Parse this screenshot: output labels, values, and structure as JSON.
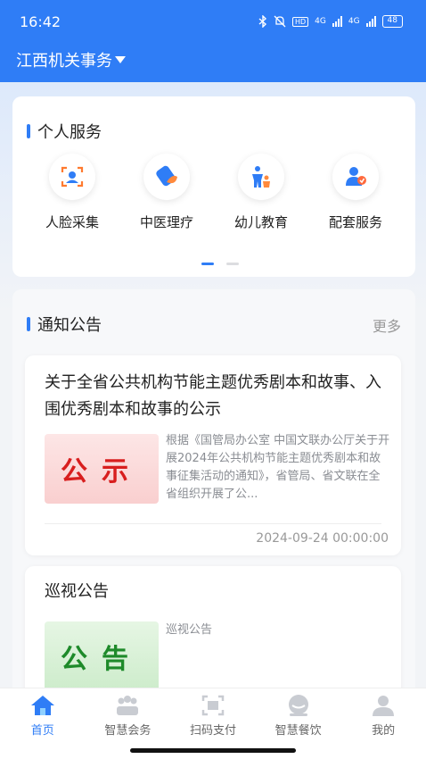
{
  "status": {
    "time": "16:42",
    "network": "4G",
    "battery": "48"
  },
  "header": {
    "org_name": "江西机关事务"
  },
  "services": {
    "title": "个人服务",
    "items": [
      {
        "label": "人脸采集",
        "icon": "face-scan-icon",
        "color": "#ff7a2f"
      },
      {
        "label": "中医理疗",
        "icon": "medicine-icon",
        "color": "#2f7df6"
      },
      {
        "label": "幼儿教育",
        "icon": "child-icon",
        "color": "#2f7df6"
      },
      {
        "label": "配套服务",
        "icon": "user-service-icon",
        "color": "#2f7df6"
      }
    ],
    "page_count": 2,
    "current_page": 1
  },
  "notices": {
    "title": "通知公告",
    "more_label": "更多",
    "items": [
      {
        "title": "关于全省公共机构节能主题优秀剧本和故事、入围优秀剧本和故事的公示",
        "thumb_text": "公示",
        "excerpt": "根据《国管局办公室 中国文联办公厅关于开展2024年公共机构节能主题优秀剧本和故事征集活动的通知》，省管局、省文联在全省组织开展了公...",
        "date": "2024-09-24 00:00:00"
      },
      {
        "title": "巡视公告",
        "thumb_text": "公告",
        "excerpt": "巡视公告"
      }
    ]
  },
  "tabbar": {
    "items": [
      {
        "label": "首页",
        "icon": "home-icon",
        "active": true
      },
      {
        "label": "智慧会务",
        "icon": "meeting-icon",
        "active": false
      },
      {
        "label": "扫码支付",
        "icon": "scan-icon",
        "active": false
      },
      {
        "label": "智慧餐饮",
        "icon": "dining-icon",
        "active": false
      },
      {
        "label": "我的",
        "icon": "profile-icon",
        "active": false
      }
    ]
  },
  "colors": {
    "primary": "#2f7df6",
    "background": "#f2f4f7"
  }
}
